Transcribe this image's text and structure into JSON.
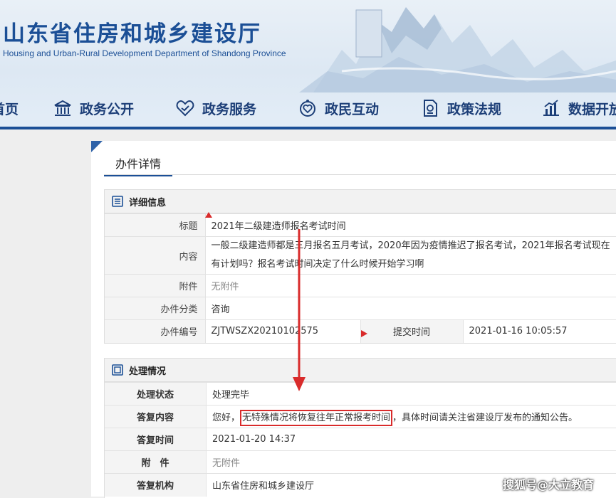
{
  "header": {
    "title": "山东省住房和城乡建设厅",
    "subtitle": "Housing and Urban-Rural Development Department of Shandong Province",
    "accent_color": "#1b4f96"
  },
  "nav": {
    "items": [
      {
        "label": "首页",
        "icon": "none"
      },
      {
        "label": "政务公开",
        "icon": "government-building-icon"
      },
      {
        "label": "政务服务",
        "icon": "handshake-heart-icon"
      },
      {
        "label": "政民互动",
        "icon": "interaction-icon"
      },
      {
        "label": "政策法规",
        "icon": "document-icon"
      },
      {
        "label": "数据开放",
        "icon": "chart-icon"
      }
    ]
  },
  "tab": {
    "label": "办件详情"
  },
  "detail": {
    "header": "详细信息",
    "rows": {
      "title_label": "标题",
      "title_value": "2021年二级建造师报名考试时间",
      "content_label": "内容",
      "content_value": "一般二级建造师都是三月报名五月考试，2020年因为疫情推迟了报名考试，2021年报名考试现在有计划吗？报名考试时间决定了什么时候开始学习啊",
      "attachment_label": "附件",
      "attachment_value": "无附件",
      "category_label": "办件分类",
      "category_value": "咨询",
      "number_label": "办件编号",
      "number_value": "ZJTWSZX20210102575",
      "submit_time_label": "提交时间",
      "submit_time_value": "2021-01-16 10:05:57"
    }
  },
  "handling": {
    "header": "处理情况",
    "rows": {
      "status_label": "处理状态",
      "status_value": "处理完毕",
      "reply_label": "答复内容",
      "reply_prefix": "您好，",
      "reply_highlight": "无特殊情况将恢复往年正常报考时间",
      "reply_suffix": "，具体时间请关注省建设厅发布的通知公告。",
      "reply_time_label": "答复时间",
      "reply_time_value": "2021-01-20 14:37",
      "attachment_label": "附　件",
      "attachment_value": "无附件",
      "org_label": "答复机构",
      "org_value": "山东省住房和城乡建设厅"
    }
  },
  "watermark": "搜狐号@大立教育",
  "annotation_color": "#d92b2b"
}
